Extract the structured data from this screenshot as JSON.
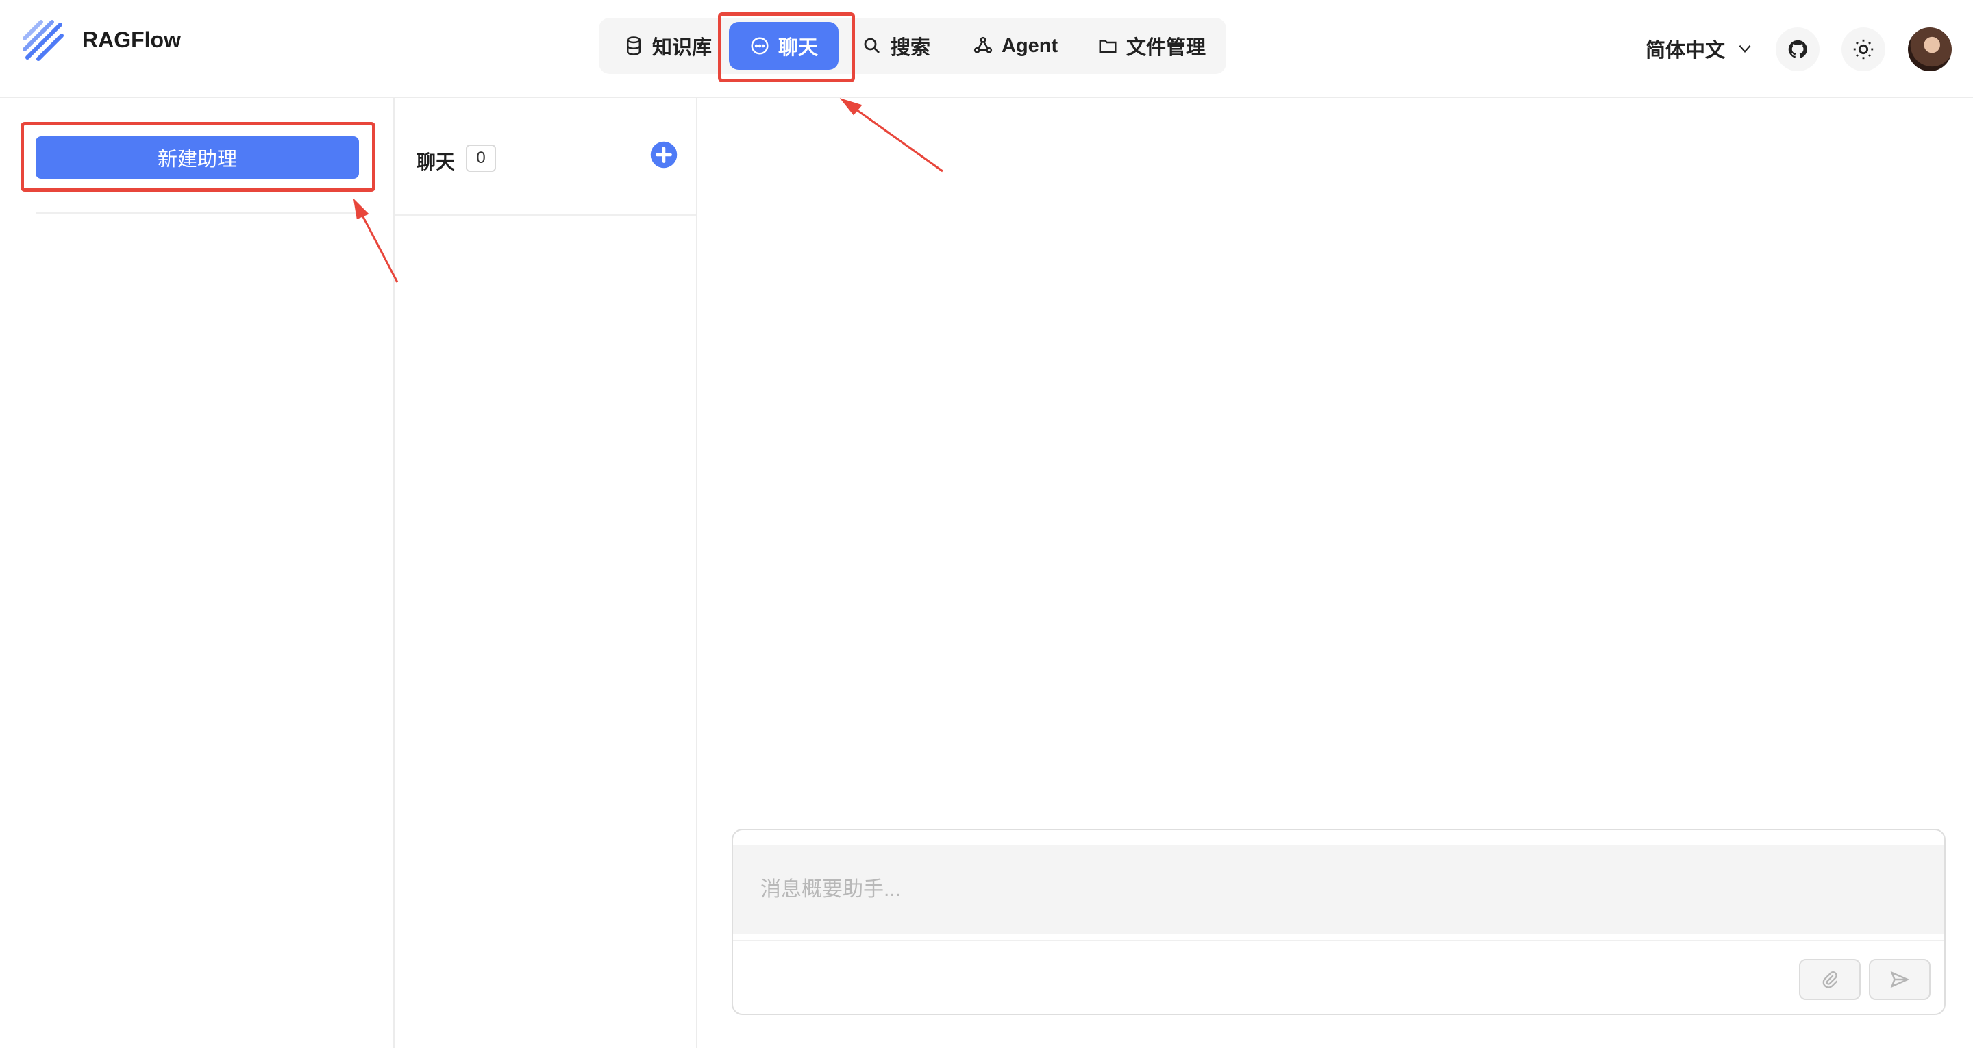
{
  "app": {
    "name": "RAGFlow"
  },
  "nav": {
    "items": [
      {
        "label": "知识库",
        "icon": "database-icon"
      },
      {
        "label": "聊天",
        "icon": "chat-bubble-icon",
        "active": true
      },
      {
        "label": "搜索",
        "icon": "search-icon"
      },
      {
        "label": "Agent",
        "icon": "agent-graph-icon"
      },
      {
        "label": "文件管理",
        "icon": "folder-icon"
      }
    ]
  },
  "header_right": {
    "language": "简体中文",
    "github_icon": "github-icon",
    "theme_icon": "sun-icon"
  },
  "sidebar": {
    "new_assistant_label": "新建助理"
  },
  "conversations": {
    "title": "聊天",
    "count": "0"
  },
  "composer": {
    "placeholder": "消息概要助手..."
  },
  "colors": {
    "accent": "#4f7bf6",
    "highlight": "#e8463b"
  }
}
